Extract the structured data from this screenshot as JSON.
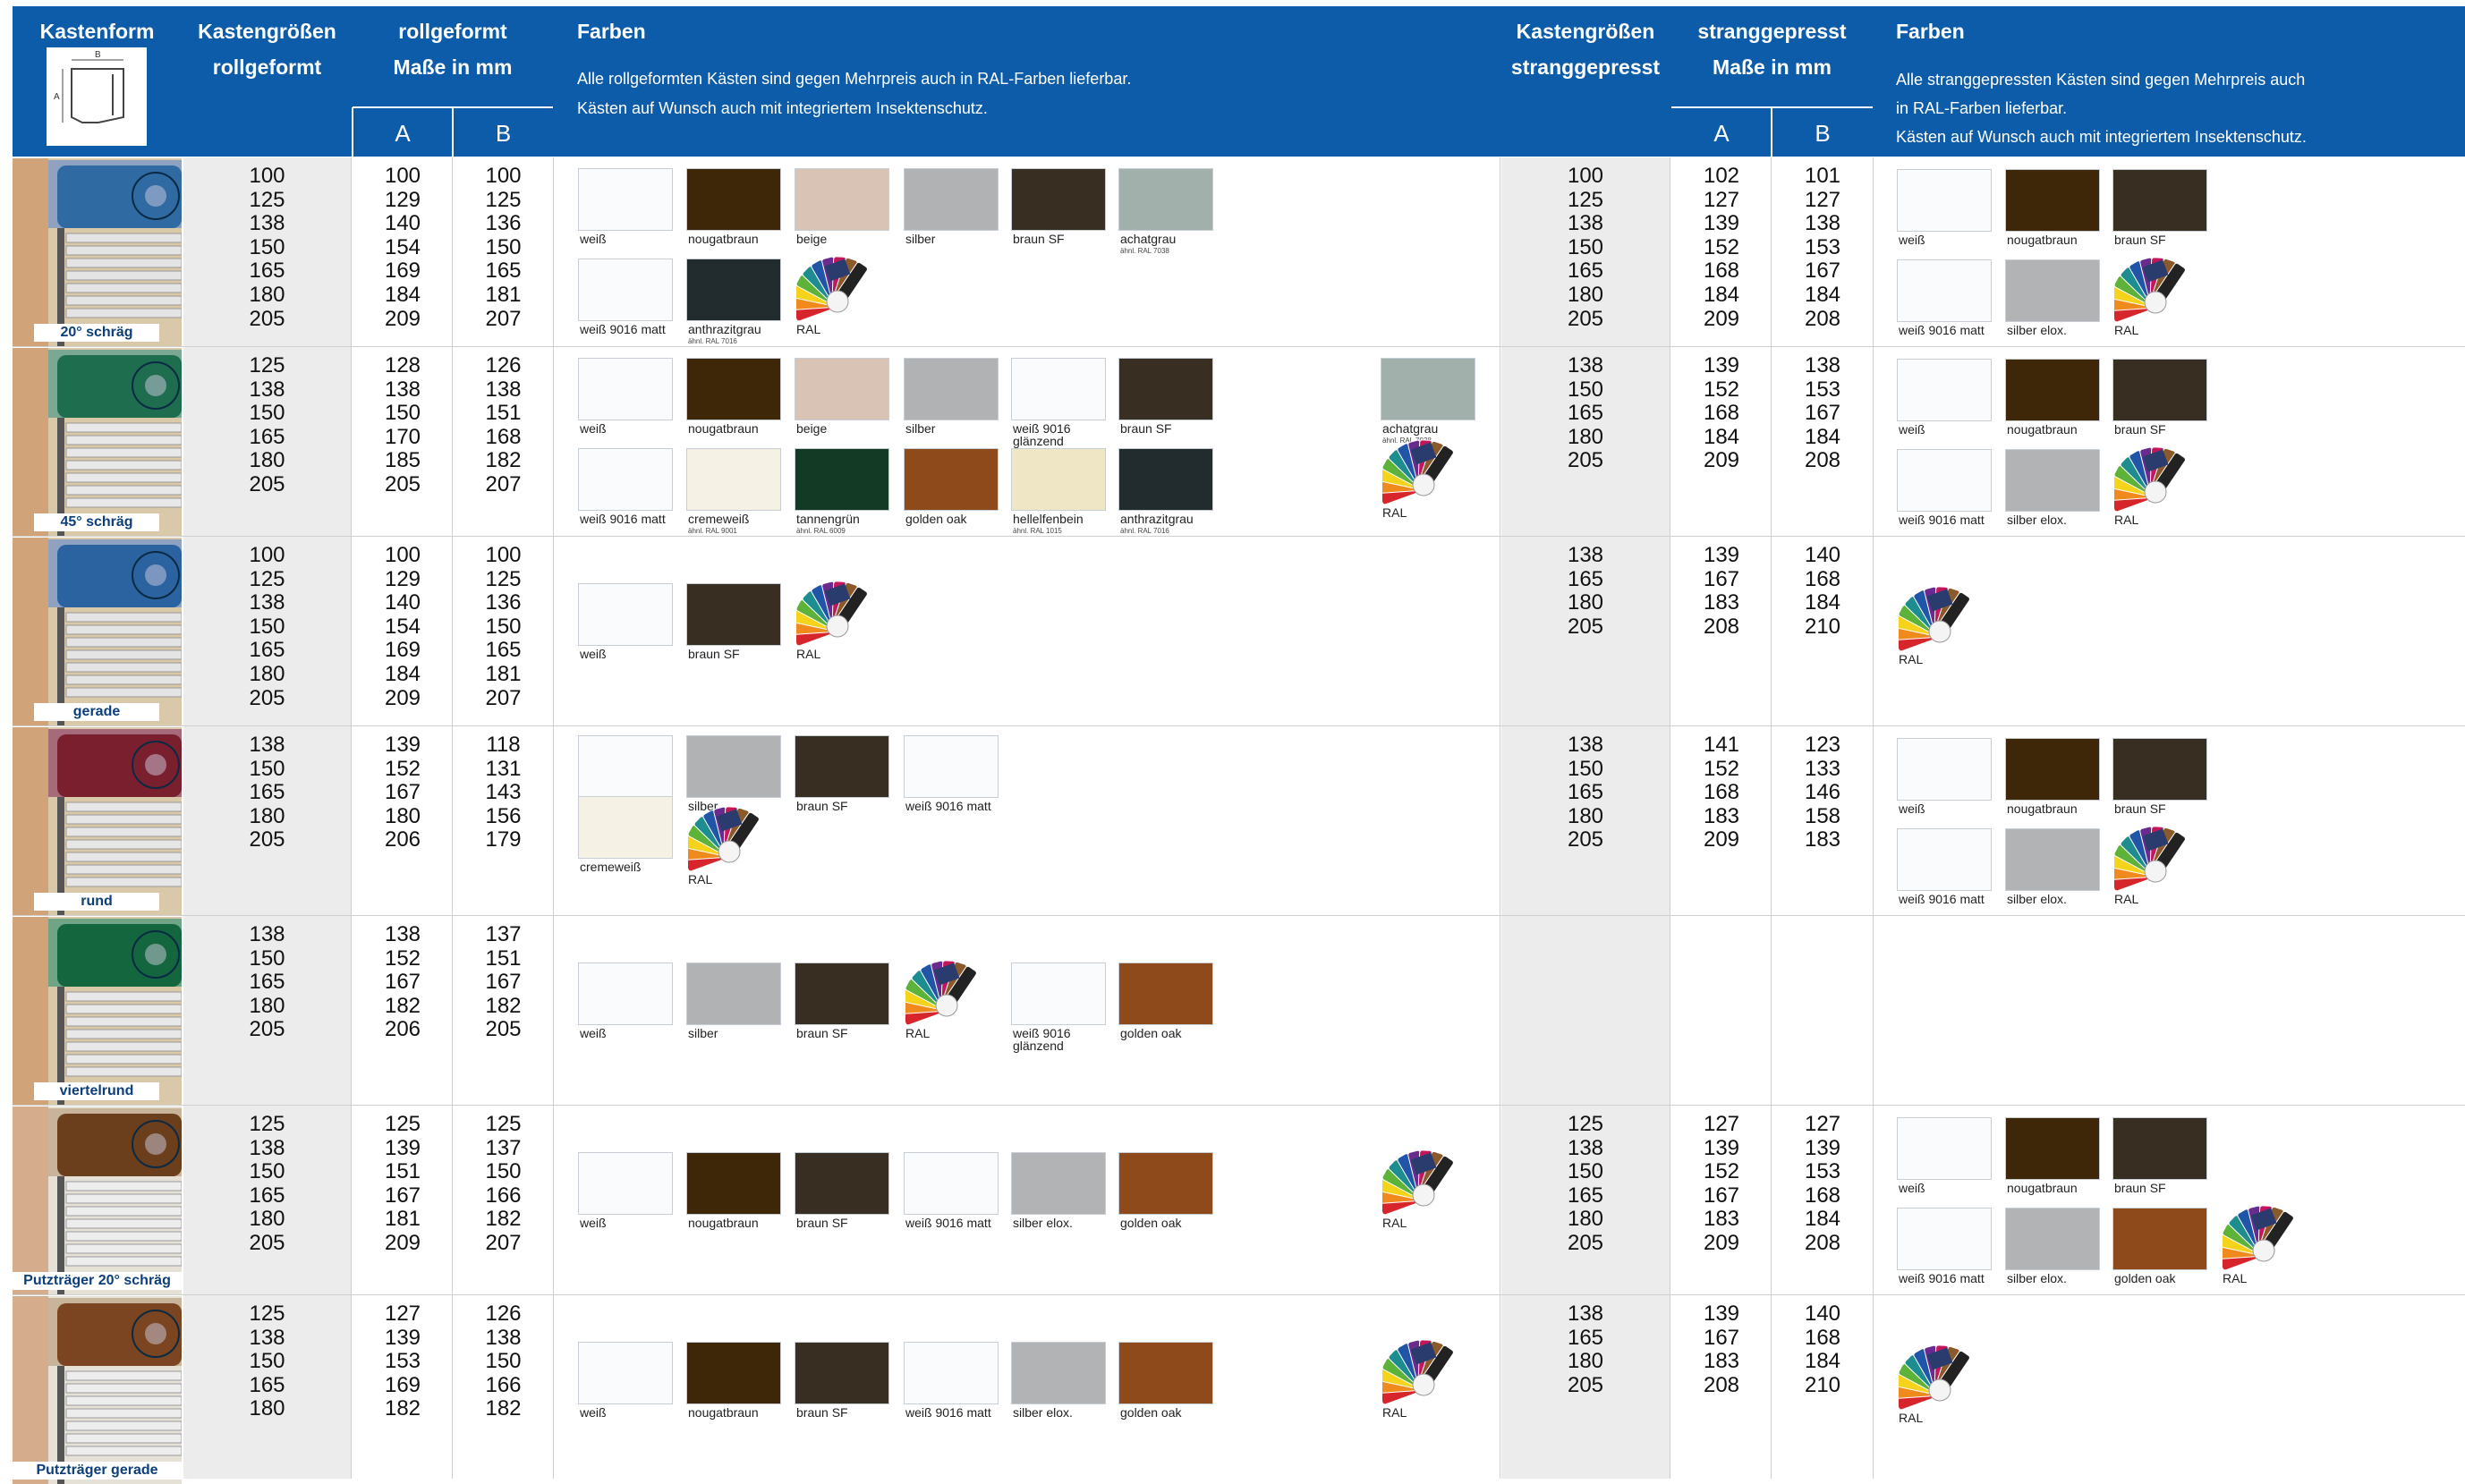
{
  "header": {
    "kastenform": "Kastenform",
    "rollgeformt_sizes": [
      "Kastengrößen",
      "rollgeformt"
    ],
    "rollgeformt_dims": [
      "rollgeformt",
      "Maße in mm"
    ],
    "farben": "Farben",
    "farben_roll_note": [
      "Alle rollgeformten Kästen sind gegen Mehrpreis auch in RAL-Farben lieferbar.",
      "Kästen auf Wunsch auch mit integriertem Insektenschutz."
    ],
    "strang_sizes": [
      "Kastengrößen",
      "stranggepresst"
    ],
    "strang_dims": [
      "stranggepresst",
      "Maße in mm"
    ],
    "farben_strang_note": [
      "Alle stranggepressten Kästen sind gegen Mehrpreis auch",
      "in RAL-Farben lieferbar.",
      "Kästen auf Wunsch auch mit integriertem Insektenschutz."
    ],
    "col_a": "A",
    "col_b": "B",
    "diagram_a": "A",
    "diagram_b": "B"
  },
  "colors": {
    "header_blue": "#0c5ca9",
    "gray_column": "#ececec",
    "caption_blue": "#0c3f7a"
  },
  "swatch_colors": {
    "weiß": "#f9fbfd",
    "weiß 9016 matt": "#f9fbfd",
    "weiß 9016 glänzend": "#f9fbfd",
    "nougatbraun": "#3e2708",
    "beige": "#d8c3b4",
    "silber": "#b1b2b4",
    "braun SF": "#392e22",
    "achatgrau": "#a2b0ac",
    "anthrazitgrau": "#222b2e",
    "cremeweiß": "#f5f2e5",
    "tannengrün": "#123a25",
    "golden oak": "#8f4a1c",
    "hellelfenbein": "#efe6c5",
    "silber elox.": "#b2b3b5"
  },
  "rows": [
    {
      "caption": "20° schräg",
      "roll_sizes": [
        "100",
        "125",
        "138",
        "150",
        "165",
        "180",
        "205"
      ],
      "roll_a": [
        "100",
        "129",
        "140",
        "154",
        "169",
        "184",
        "209"
      ],
      "roll_b": [
        "100",
        "125",
        "136",
        "150",
        "165",
        "181",
        "207"
      ],
      "strang_sizes": [
        "100",
        "125",
        "138",
        "150",
        "165",
        "180",
        "205"
      ],
      "strang_a": [
        "102",
        "127",
        "139",
        "152",
        "168",
        "184",
        "209"
      ],
      "strang_b": [
        "101",
        "127",
        "138",
        "153",
        "167",
        "184",
        "208"
      ]
    },
    {
      "caption": "45° schräg",
      "roll_sizes": [
        "125",
        "138",
        "150",
        "165",
        "180",
        "205"
      ],
      "roll_a": [
        "128",
        "138",
        "150",
        "170",
        "185",
        "205"
      ],
      "roll_b": [
        "126",
        "138",
        "151",
        "168",
        "182",
        "207"
      ],
      "strang_sizes": [
        "138",
        "150",
        "165",
        "180",
        "205"
      ],
      "strang_a": [
        "139",
        "152",
        "168",
        "184",
        "209"
      ],
      "strang_b": [
        "138",
        "153",
        "167",
        "184",
        "208"
      ]
    },
    {
      "caption": "gerade",
      "roll_sizes": [
        "100",
        "125",
        "138",
        "150",
        "165",
        "180",
        "205"
      ],
      "roll_a": [
        "100",
        "129",
        "140",
        "154",
        "169",
        "184",
        "209"
      ],
      "roll_b": [
        "100",
        "125",
        "136",
        "150",
        "165",
        "181",
        "207"
      ],
      "strang_sizes": [
        "138",
        "165",
        "180",
        "205"
      ],
      "strang_a": [
        "139",
        "167",
        "183",
        "208"
      ],
      "strang_b": [
        "140",
        "168",
        "184",
        "210"
      ]
    },
    {
      "caption": "rund",
      "roll_sizes": [
        "138",
        "150",
        "165",
        "180",
        "205"
      ],
      "roll_a": [
        "139",
        "152",
        "167",
        "180",
        "206"
      ],
      "roll_b": [
        "118",
        "131",
        "143",
        "156",
        "179"
      ],
      "strang_sizes": [
        "138",
        "150",
        "165",
        "180",
        "205"
      ],
      "strang_a": [
        "141",
        "152",
        "168",
        "183",
        "209"
      ],
      "strang_b": [
        "123",
        "133",
        "146",
        "158",
        "183"
      ]
    },
    {
      "caption": "viertelrund",
      "roll_sizes": [
        "138",
        "150",
        "165",
        "180",
        "205"
      ],
      "roll_a": [
        "138",
        "152",
        "167",
        "182",
        "206"
      ],
      "roll_b": [
        "137",
        "151",
        "167",
        "182",
        "205"
      ],
      "strang_sizes": [],
      "strang_a": [],
      "strang_b": []
    },
    {
      "caption": "Putzträger 20° schräg",
      "roll_sizes": [
        "125",
        "138",
        "150",
        "165",
        "180",
        "205"
      ],
      "roll_a": [
        "125",
        "139",
        "151",
        "167",
        "181",
        "209"
      ],
      "roll_b": [
        "125",
        "137",
        "150",
        "166",
        "182",
        "207"
      ],
      "strang_sizes": [
        "125",
        "138",
        "150",
        "165",
        "180",
        "205"
      ],
      "strang_a": [
        "127",
        "139",
        "152",
        "167",
        "183",
        "209"
      ],
      "strang_b": [
        "127",
        "139",
        "153",
        "168",
        "184",
        "208"
      ]
    },
    {
      "caption": "Putzträger gerade",
      "roll_sizes": [
        "125",
        "138",
        "150",
        "165",
        "180"
      ],
      "roll_a": [
        "127",
        "139",
        "153",
        "169",
        "182"
      ],
      "roll_b": [
        "126",
        "138",
        "150",
        "166",
        "182"
      ],
      "strang_sizes": [
        "138",
        "165",
        "180",
        "205"
      ],
      "strang_a": [
        "139",
        "167",
        "183",
        "208"
      ],
      "strang_b": [
        "140",
        "168",
        "184",
        "210"
      ]
    }
  ],
  "ral_label": "RAL",
  "roll_swatches": [
    [
      {
        "label": "weiß",
        "sub": ""
      },
      {
        "label": "nougatbraun",
        "sub": ""
      },
      {
        "label": "beige",
        "sub": ""
      },
      {
        "label": "silber",
        "sub": ""
      },
      {
        "label": "braun SF",
        "sub": ""
      },
      {
        "label": "achatgrau",
        "sub": "ähnl. RAL 7038"
      },
      {
        "label": "weiß 9016 matt",
        "sub": ""
      },
      {
        "label": "anthrazitgrau",
        "sub": "ähnl. RAL 7016"
      },
      {
        "label": "RAL",
        "sub": ""
      }
    ],
    [
      {
        "label": "weiß",
        "sub": ""
      },
      {
        "label": "nougatbraun",
        "sub": ""
      },
      {
        "label": "beige",
        "sub": ""
      },
      {
        "label": "silber",
        "sub": ""
      },
      {
        "label": "weiß 9016",
        "label2": "glänzend",
        "sub": ""
      },
      {
        "label": "braun SF",
        "sub": ""
      },
      {
        "label": "achatgrau",
        "sub": "ähnl. RAL 7038"
      },
      {
        "label": "weiß 9016 matt",
        "sub": ""
      },
      {
        "label": "cremeweiß",
        "sub": "ähnl. RAL 9001"
      },
      {
        "label": "tannengrün",
        "sub": "ähnl. RAL 6009"
      },
      {
        "label": "golden oak",
        "sub": ""
      },
      {
        "label": "hellelfenbein",
        "sub": "ähnl. RAL 1015"
      },
      {
        "label": "anthrazitgrau",
        "sub": "ähnl. RAL 7016"
      },
      {
        "label": "RAL",
        "sub": ""
      }
    ],
    [
      {
        "label": "weiß",
        "sub": ""
      },
      {
        "label": "braun SF",
        "sub": ""
      },
      {
        "label": "RAL",
        "sub": ""
      }
    ],
    [
      {
        "label": "weiß",
        "sub": ""
      },
      {
        "label": "silber",
        "sub": ""
      },
      {
        "label": "braun SF",
        "sub": ""
      },
      {
        "label": "weiß 9016 matt",
        "sub": ""
      },
      {
        "label": "cremeweiß",
        "sub": ""
      },
      {
        "label": "RAL",
        "sub": ""
      }
    ],
    [
      {
        "label": "weiß",
        "sub": ""
      },
      {
        "label": "silber",
        "sub": ""
      },
      {
        "label": "braun SF",
        "sub": ""
      },
      {
        "label": "RAL",
        "sub": ""
      },
      {
        "label": "weiß 9016",
        "label2": "glänzend",
        "sub": ""
      },
      {
        "label": "golden oak",
        "sub": ""
      }
    ],
    [
      {
        "label": "weiß",
        "sub": ""
      },
      {
        "label": "nougatbraun",
        "sub": ""
      },
      {
        "label": "braun SF",
        "sub": ""
      },
      {
        "label": "weiß 9016 matt",
        "sub": ""
      },
      {
        "label": "silber elox.",
        "sub": ""
      },
      {
        "label": "golden oak",
        "sub": ""
      },
      {
        "label": "RAL",
        "sub": ""
      }
    ],
    [
      {
        "label": "weiß",
        "sub": ""
      },
      {
        "label": "nougatbraun",
        "sub": ""
      },
      {
        "label": "braun SF",
        "sub": ""
      },
      {
        "label": "weiß 9016 matt",
        "sub": ""
      },
      {
        "label": "silber elox.",
        "sub": ""
      },
      {
        "label": "golden oak",
        "sub": ""
      },
      {
        "label": "RAL",
        "sub": ""
      }
    ]
  ],
  "strang_swatches": [
    [
      {
        "label": "weiß"
      },
      {
        "label": "nougatbraun"
      },
      {
        "label": "braun SF"
      },
      {
        "label": "weiß 9016 matt"
      },
      {
        "label": "silber elox."
      },
      {
        "label": "RAL"
      }
    ],
    [
      {
        "label": "weiß"
      },
      {
        "label": "nougatbraun"
      },
      {
        "label": "braun SF"
      },
      {
        "label": "weiß 9016 matt"
      },
      {
        "label": "silber elox."
      },
      {
        "label": "RAL"
      }
    ],
    [
      {
        "label": "RAL"
      }
    ],
    [
      {
        "label": "weiß"
      },
      {
        "label": "nougatbraun"
      },
      {
        "label": "braun SF"
      },
      {
        "label": "weiß 9016 matt"
      },
      {
        "label": "silber elox."
      },
      {
        "label": "RAL"
      }
    ],
    [],
    [
      {
        "label": "weiß"
      },
      {
        "label": "nougatbraun"
      },
      {
        "label": "braun SF"
      },
      {
        "label": "weiß 9016 matt"
      },
      {
        "label": "silber elox."
      },
      {
        "label": "golden oak"
      },
      {
        "label": "RAL"
      }
    ],
    [
      {
        "label": "RAL"
      }
    ]
  ]
}
